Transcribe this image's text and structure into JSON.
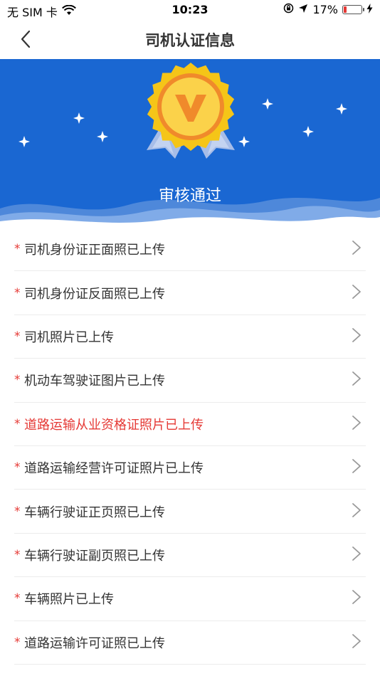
{
  "status_bar": {
    "carrier": "无 SIM 卡",
    "time": "10:23",
    "battery": "17%",
    "battery_level": 0.17,
    "icons": [
      "wifi-icon",
      "orientation-lock-icon",
      "location-arrow-icon",
      "battery-icon",
      "charging-icon"
    ]
  },
  "nav": {
    "title": "司机认证信息",
    "back_icon": "chevron-left-icon"
  },
  "hero": {
    "status_text": "审核通过",
    "badge_icon": "verified-medal-icon",
    "colors": {
      "background": "#1a67d2",
      "medal": "#f5c518",
      "ribbon": "#9fb7e6"
    }
  },
  "items": [
    {
      "label": "司机身份证正面照已上传",
      "highlight": false
    },
    {
      "label": "司机身份证反面照已上传",
      "highlight": false
    },
    {
      "label": "司机照片已上传",
      "highlight": false
    },
    {
      "label": "机动车驾驶证图片已上传",
      "highlight": false
    },
    {
      "label": "道路运输从业资格证照片已上传",
      "highlight": true
    },
    {
      "label": "道路运输经营许可证照片已上传",
      "highlight": false
    },
    {
      "label": "车辆行驶证正页照已上传",
      "highlight": false
    },
    {
      "label": "车辆行驶证副页照已上传",
      "highlight": false
    },
    {
      "label": "车辆照片已上传",
      "highlight": false
    },
    {
      "label": "道路运输许可证照已上传",
      "highlight": false
    }
  ],
  "required_mark": "*",
  "colors": {
    "required": "#e53935",
    "highlight_text": "#e53935",
    "text": "#333333"
  }
}
